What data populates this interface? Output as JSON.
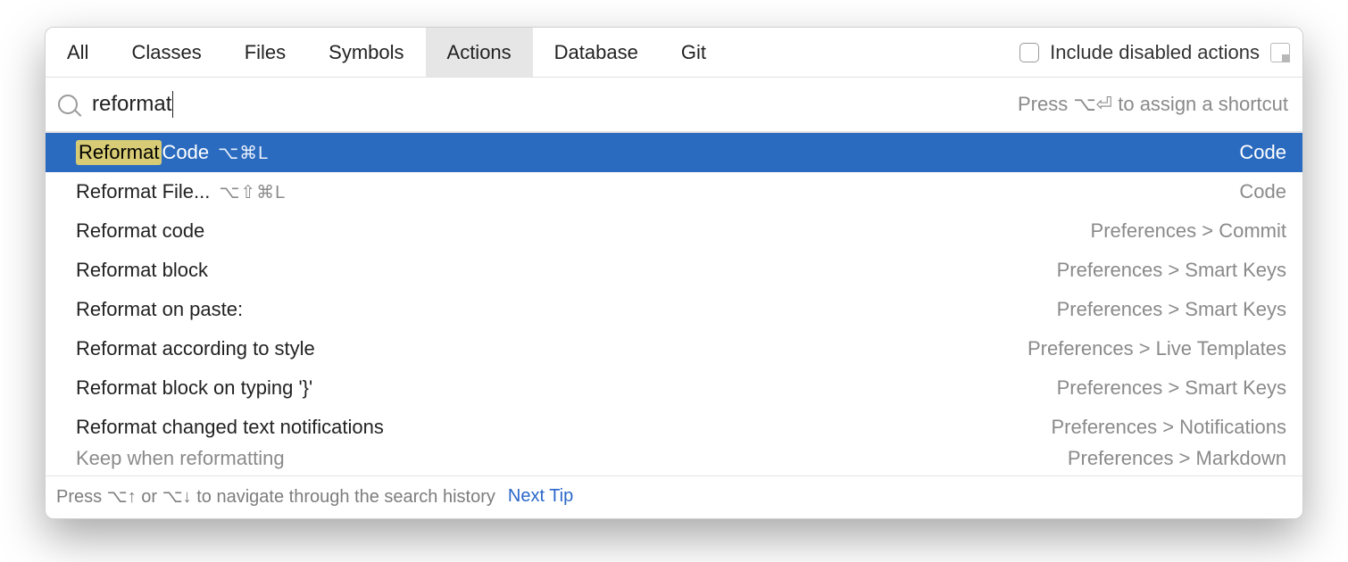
{
  "tabs": {
    "items": [
      "All",
      "Classes",
      "Files",
      "Symbols",
      "Actions",
      "Database",
      "Git"
    ],
    "active_index": 4
  },
  "include_disabled": {
    "label": "Include disabled actions",
    "checked": false
  },
  "search": {
    "value": "reformat",
    "hint": "Press ⌥⏎ to assign a shortcut"
  },
  "results": [
    {
      "match": "Reformat",
      "rest": " Code",
      "shortcut": "⌥⌘L",
      "location": "Code",
      "selected": true
    },
    {
      "match": "",
      "rest": "Reformat File...",
      "shortcut": "⌥⇧⌘L",
      "location": "Code",
      "selected": false
    },
    {
      "match": "",
      "rest": "Reformat code",
      "shortcut": "",
      "location": "Preferences > Commit",
      "selected": false
    },
    {
      "match": "",
      "rest": "Reformat block",
      "shortcut": "",
      "location": "Preferences > Smart Keys",
      "selected": false
    },
    {
      "match": "",
      "rest": "Reformat on paste:",
      "shortcut": "",
      "location": "Preferences > Smart Keys",
      "selected": false
    },
    {
      "match": "",
      "rest": "Reformat according to style",
      "shortcut": "",
      "location": "Preferences > Live Templates",
      "selected": false
    },
    {
      "match": "",
      "rest": "Reformat block on typing '}'",
      "shortcut": "",
      "location": "Preferences > Smart Keys",
      "selected": false
    },
    {
      "match": "",
      "rest": "Reformat changed text notifications",
      "shortcut": "",
      "location": "Preferences > Notifications",
      "selected": false
    }
  ],
  "cut_row": {
    "label": "Keep when reformatting",
    "location": "Preferences > Markdown"
  },
  "footer": {
    "tip": "Press ⌥↑ or ⌥↓ to navigate through the search history",
    "next": "Next Tip"
  }
}
